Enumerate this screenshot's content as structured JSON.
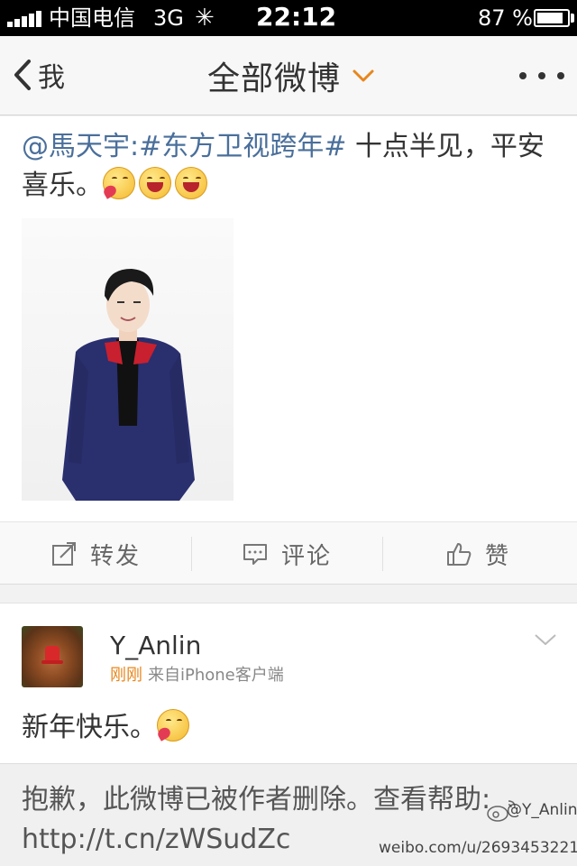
{
  "status_bar": {
    "carrier": "中国电信",
    "network": "3G",
    "time": "22:12",
    "battery": "87 %",
    "battery_level": 0.87
  },
  "nav": {
    "back_label": "我",
    "title": "全部微博",
    "accent_color": "#e8861c"
  },
  "post": {
    "mention": "@馬天宇",
    "hashtag": ":#东方卫视跨年#",
    "text": " 十点半见，平安喜乐。",
    "emoji_icons": [
      "kiss-emoji-icon",
      "laugh-emoji-icon",
      "laugh-emoji-icon"
    ],
    "link_color": "#4a6f9b"
  },
  "actions": [
    {
      "label": "转发",
      "icon": "repost-icon"
    },
    {
      "label": "评论",
      "icon": "comment-icon"
    },
    {
      "label": "赞",
      "icon": "thumbs-up-icon"
    }
  ],
  "comment": {
    "user": "Y_Anlin",
    "time": "刚刚",
    "source": "来自iPhone客户端",
    "text": "新年快乐。",
    "emoji_icon": "kiss-emoji-icon"
  },
  "deleted_notice": {
    "text": "抱歉，此微博已被作者删除。查看帮助: http://t.cn/zWSudZc"
  },
  "watermark": {
    "user": "@Y_Anlin",
    "url": "weibo.com/u/2693453221"
  }
}
